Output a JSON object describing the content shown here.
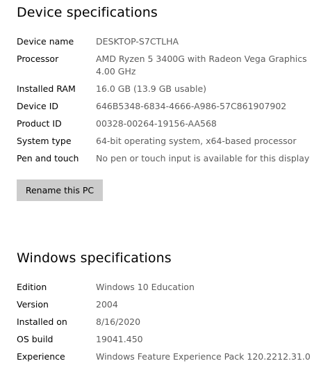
{
  "device_specifications": {
    "title": "Device specifications",
    "rows": [
      {
        "label": "Device name",
        "value": "DESKTOP-S7CTLHA"
      },
      {
        "label": "Processor",
        "value": "AMD Ryzen 5 3400G with Radeon Vega Graphics 4.00 GHz"
      },
      {
        "label": "Installed RAM",
        "value": "16.0 GB (13.9 GB usable)"
      },
      {
        "label": "Device ID",
        "value": "646B5348-6834-4666-A986-57C861907902"
      },
      {
        "label": "Product ID",
        "value": "00328-00264-19156-AA568"
      },
      {
        "label": "System type",
        "value": "64-bit operating system, x64-based processor"
      },
      {
        "label": "Pen and touch",
        "value": "No pen or touch input is available for this display"
      }
    ],
    "rename_button_label": "Rename this PC"
  },
  "windows_specifications": {
    "title": "Windows specifications",
    "rows": [
      {
        "label": "Edition",
        "value": "Windows 10 Education"
      },
      {
        "label": "Version",
        "value": "2004"
      },
      {
        "label": "Installed on",
        "value": "8/16/2020"
      },
      {
        "label": "OS build",
        "value": "19041.450"
      },
      {
        "label": "Experience",
        "value": "Windows Feature Experience Pack 120.2212.31.0"
      }
    ]
  },
  "colors": {
    "label_text": "#000000",
    "value_text": "#5c5c5c",
    "button_background": "#cccccc",
    "background": "#ffffff"
  }
}
